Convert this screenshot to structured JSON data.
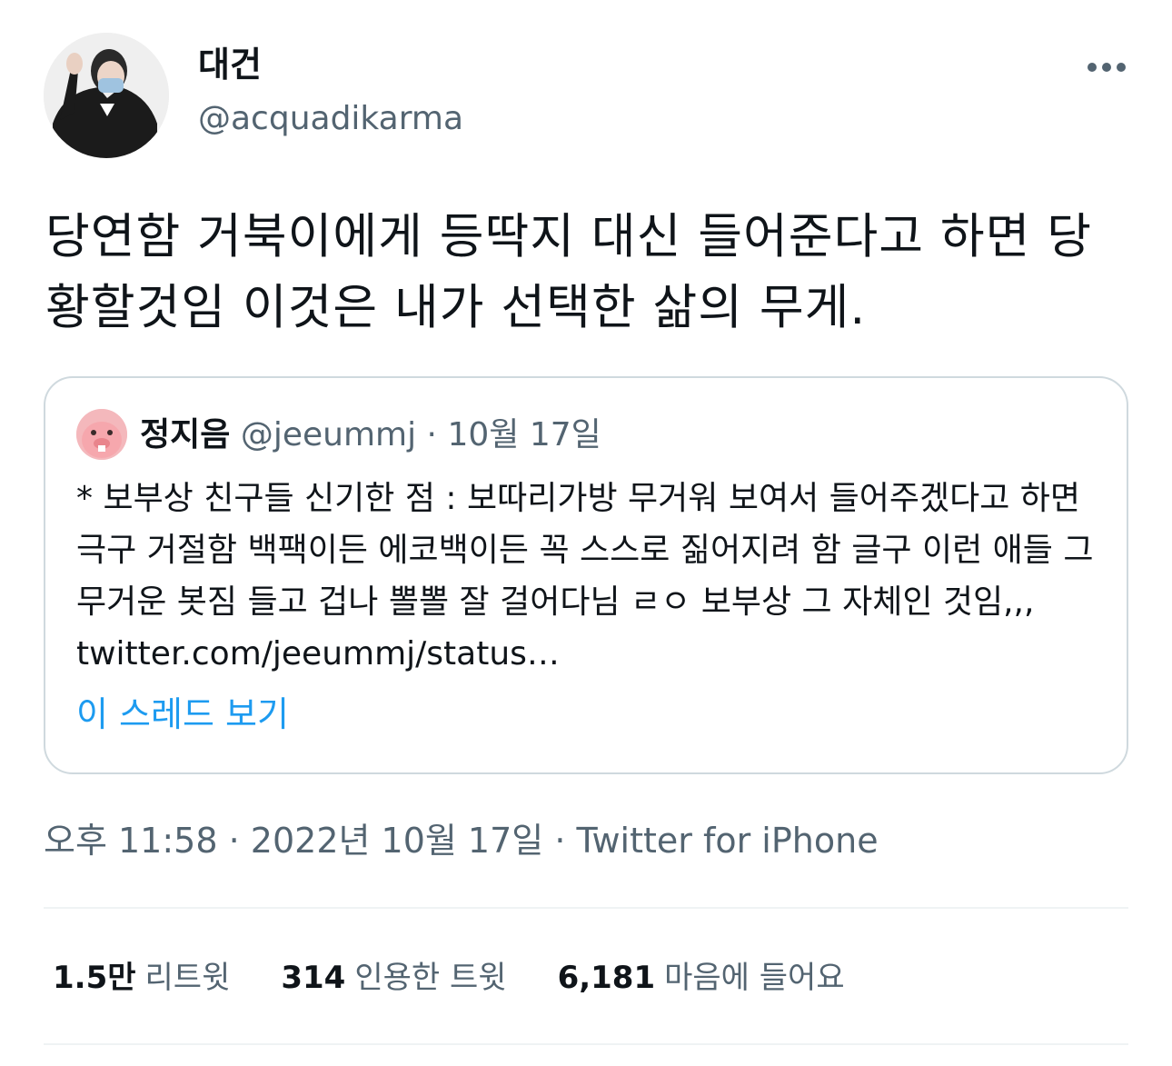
{
  "author": {
    "display_name": "대건",
    "handle": "@acquadikarma"
  },
  "tweet": {
    "text": "당연함 거북이에게 등딱지 대신 들어준다고 하면 당황할것임 이것은 내가 선택한 삶의 무게."
  },
  "quoted_tweet": {
    "display_name": "정지음",
    "handle": "@jeeummj",
    "separator": "·",
    "date": "10월 17일",
    "text": "* 보부상 친구들 신기한 점 : 보따리가방 무거워 보여서 들어주겠다고 하면 극구 거절함 백팩이든 에코백이든 꼭 스스로 짊어지려 함 글구 이런 애들 그 무거운 봇짐 들고 겁나 뽈뽈 잘 걸어다님 ㄹㅇ 보부상 그 자체인 것임,,, twitter.com/jeeummj/status…",
    "thread_link": "이 스레드 보기"
  },
  "meta": {
    "time": "오후 11:58",
    "separator": "·",
    "date": "2022년 10월 17일",
    "source": "Twitter for iPhone"
  },
  "stats": {
    "retweets_count": "1.5만",
    "retweets_label": "리트윗",
    "quotes_count": "314",
    "quotes_label": "인용한 트윗",
    "likes_count": "6,181",
    "likes_label": "마음에 들어요"
  },
  "colors": {
    "link": "#1d9bf0",
    "secondary_text": "#536471",
    "border": "#cfd9de"
  }
}
